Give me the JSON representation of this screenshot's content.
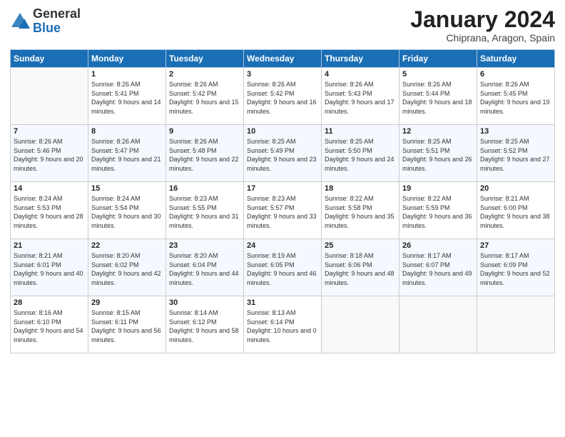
{
  "logo": {
    "general": "General",
    "blue": "Blue"
  },
  "title": "January 2024",
  "location": "Chiprana, Aragon, Spain",
  "days_of_week": [
    "Sunday",
    "Monday",
    "Tuesday",
    "Wednesday",
    "Thursday",
    "Friday",
    "Saturday"
  ],
  "weeks": [
    [
      {
        "day": "",
        "sunrise": "",
        "sunset": "",
        "daylight": ""
      },
      {
        "day": "1",
        "sunrise": "Sunrise: 8:26 AM",
        "sunset": "Sunset: 5:41 PM",
        "daylight": "Daylight: 9 hours and 14 minutes."
      },
      {
        "day": "2",
        "sunrise": "Sunrise: 8:26 AM",
        "sunset": "Sunset: 5:42 PM",
        "daylight": "Daylight: 9 hours and 15 minutes."
      },
      {
        "day": "3",
        "sunrise": "Sunrise: 8:26 AM",
        "sunset": "Sunset: 5:42 PM",
        "daylight": "Daylight: 9 hours and 16 minutes."
      },
      {
        "day": "4",
        "sunrise": "Sunrise: 8:26 AM",
        "sunset": "Sunset: 5:43 PM",
        "daylight": "Daylight: 9 hours and 17 minutes."
      },
      {
        "day": "5",
        "sunrise": "Sunrise: 8:26 AM",
        "sunset": "Sunset: 5:44 PM",
        "daylight": "Daylight: 9 hours and 18 minutes."
      },
      {
        "day": "6",
        "sunrise": "Sunrise: 8:26 AM",
        "sunset": "Sunset: 5:45 PM",
        "daylight": "Daylight: 9 hours and 19 minutes."
      }
    ],
    [
      {
        "day": "7",
        "sunrise": "Sunrise: 8:26 AM",
        "sunset": "Sunset: 5:46 PM",
        "daylight": "Daylight: 9 hours and 20 minutes."
      },
      {
        "day": "8",
        "sunrise": "Sunrise: 8:26 AM",
        "sunset": "Sunset: 5:47 PM",
        "daylight": "Daylight: 9 hours and 21 minutes."
      },
      {
        "day": "9",
        "sunrise": "Sunrise: 8:26 AM",
        "sunset": "Sunset: 5:48 PM",
        "daylight": "Daylight: 9 hours and 22 minutes."
      },
      {
        "day": "10",
        "sunrise": "Sunrise: 8:25 AM",
        "sunset": "Sunset: 5:49 PM",
        "daylight": "Daylight: 9 hours and 23 minutes."
      },
      {
        "day": "11",
        "sunrise": "Sunrise: 8:25 AM",
        "sunset": "Sunset: 5:50 PM",
        "daylight": "Daylight: 9 hours and 24 minutes."
      },
      {
        "day": "12",
        "sunrise": "Sunrise: 8:25 AM",
        "sunset": "Sunset: 5:51 PM",
        "daylight": "Daylight: 9 hours and 26 minutes."
      },
      {
        "day": "13",
        "sunrise": "Sunrise: 8:25 AM",
        "sunset": "Sunset: 5:52 PM",
        "daylight": "Daylight: 9 hours and 27 minutes."
      }
    ],
    [
      {
        "day": "14",
        "sunrise": "Sunrise: 8:24 AM",
        "sunset": "Sunset: 5:53 PM",
        "daylight": "Daylight: 9 hours and 28 minutes."
      },
      {
        "day": "15",
        "sunrise": "Sunrise: 8:24 AM",
        "sunset": "Sunset: 5:54 PM",
        "daylight": "Daylight: 9 hours and 30 minutes."
      },
      {
        "day": "16",
        "sunrise": "Sunrise: 8:23 AM",
        "sunset": "Sunset: 5:55 PM",
        "daylight": "Daylight: 9 hours and 31 minutes."
      },
      {
        "day": "17",
        "sunrise": "Sunrise: 8:23 AM",
        "sunset": "Sunset: 5:57 PM",
        "daylight": "Daylight: 9 hours and 33 minutes."
      },
      {
        "day": "18",
        "sunrise": "Sunrise: 8:22 AM",
        "sunset": "Sunset: 5:58 PM",
        "daylight": "Daylight: 9 hours and 35 minutes."
      },
      {
        "day": "19",
        "sunrise": "Sunrise: 8:22 AM",
        "sunset": "Sunset: 5:59 PM",
        "daylight": "Daylight: 9 hours and 36 minutes."
      },
      {
        "day": "20",
        "sunrise": "Sunrise: 8:21 AM",
        "sunset": "Sunset: 6:00 PM",
        "daylight": "Daylight: 9 hours and 38 minutes."
      }
    ],
    [
      {
        "day": "21",
        "sunrise": "Sunrise: 8:21 AM",
        "sunset": "Sunset: 6:01 PM",
        "daylight": "Daylight: 9 hours and 40 minutes."
      },
      {
        "day": "22",
        "sunrise": "Sunrise: 8:20 AM",
        "sunset": "Sunset: 6:02 PM",
        "daylight": "Daylight: 9 hours and 42 minutes."
      },
      {
        "day": "23",
        "sunrise": "Sunrise: 8:20 AM",
        "sunset": "Sunset: 6:04 PM",
        "daylight": "Daylight: 9 hours and 44 minutes."
      },
      {
        "day": "24",
        "sunrise": "Sunrise: 8:19 AM",
        "sunset": "Sunset: 6:05 PM",
        "daylight": "Daylight: 9 hours and 46 minutes."
      },
      {
        "day": "25",
        "sunrise": "Sunrise: 8:18 AM",
        "sunset": "Sunset: 6:06 PM",
        "daylight": "Daylight: 9 hours and 48 minutes."
      },
      {
        "day": "26",
        "sunrise": "Sunrise: 8:17 AM",
        "sunset": "Sunset: 6:07 PM",
        "daylight": "Daylight: 9 hours and 49 minutes."
      },
      {
        "day": "27",
        "sunrise": "Sunrise: 8:17 AM",
        "sunset": "Sunset: 6:09 PM",
        "daylight": "Daylight: 9 hours and 52 minutes."
      }
    ],
    [
      {
        "day": "28",
        "sunrise": "Sunrise: 8:16 AM",
        "sunset": "Sunset: 6:10 PM",
        "daylight": "Daylight: 9 hours and 54 minutes."
      },
      {
        "day": "29",
        "sunrise": "Sunrise: 8:15 AM",
        "sunset": "Sunset: 6:11 PM",
        "daylight": "Daylight: 9 hours and 56 minutes."
      },
      {
        "day": "30",
        "sunrise": "Sunrise: 8:14 AM",
        "sunset": "Sunset: 6:12 PM",
        "daylight": "Daylight: 9 hours and 58 minutes."
      },
      {
        "day": "31",
        "sunrise": "Sunrise: 8:13 AM",
        "sunset": "Sunset: 6:14 PM",
        "daylight": "Daylight: 10 hours and 0 minutes."
      },
      {
        "day": "",
        "sunrise": "",
        "sunset": "",
        "daylight": ""
      },
      {
        "day": "",
        "sunrise": "",
        "sunset": "",
        "daylight": ""
      },
      {
        "day": "",
        "sunrise": "",
        "sunset": "",
        "daylight": ""
      }
    ]
  ]
}
